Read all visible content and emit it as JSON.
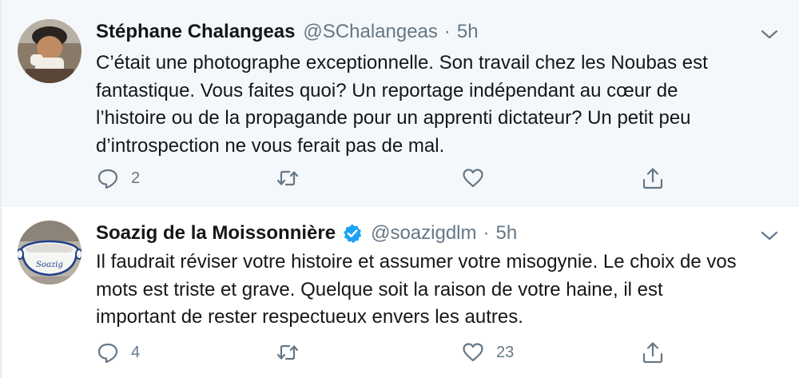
{
  "tweets": [
    {
      "author_name": "Stéphane Chalangeas",
      "handle": "@SChalangeas",
      "separator": "·",
      "time": "5h",
      "verified": false,
      "text_lines": [
        "C’était une photographe exceptionnelle. Son travail chez les Noubas est",
        "fantastique. Vous faites quoi? Un reportage indépendant au cœur de",
        "l’histoire ou de la propagande pour un apprenti dictateur? Un petit peu",
        "d’introspection ne vous ferait pas de mal."
      ],
      "reply_count": "2",
      "retweet_count": "",
      "like_count": ""
    },
    {
      "author_name": "Soazig de la Moissonnière",
      "handle": "@soazigdlm",
      "separator": "·",
      "time": "5h",
      "verified": true,
      "text_lines": [
        "Il faudrait réviser votre histoire et assumer votre misogynie. Le choix de vos",
        "mots est triste et grave. Quelque soit la raison de votre haine, il est",
        "important de rester respectueux envers les autres."
      ],
      "reply_count": "4",
      "retweet_count": "",
      "like_count": "23",
      "avatar_bowl_text": "Soazig"
    }
  ],
  "icons": {
    "reply": "reply-icon",
    "retweet": "retweet-icon",
    "like": "heart-icon",
    "share": "share-icon",
    "menu": "chevron-down-icon",
    "verified": "verified-badge-icon"
  },
  "colors": {
    "text_primary": "#14171a",
    "text_secondary": "#657786",
    "verified_blue": "#1da1f2",
    "highlight_bg": "#f5f8fa"
  }
}
